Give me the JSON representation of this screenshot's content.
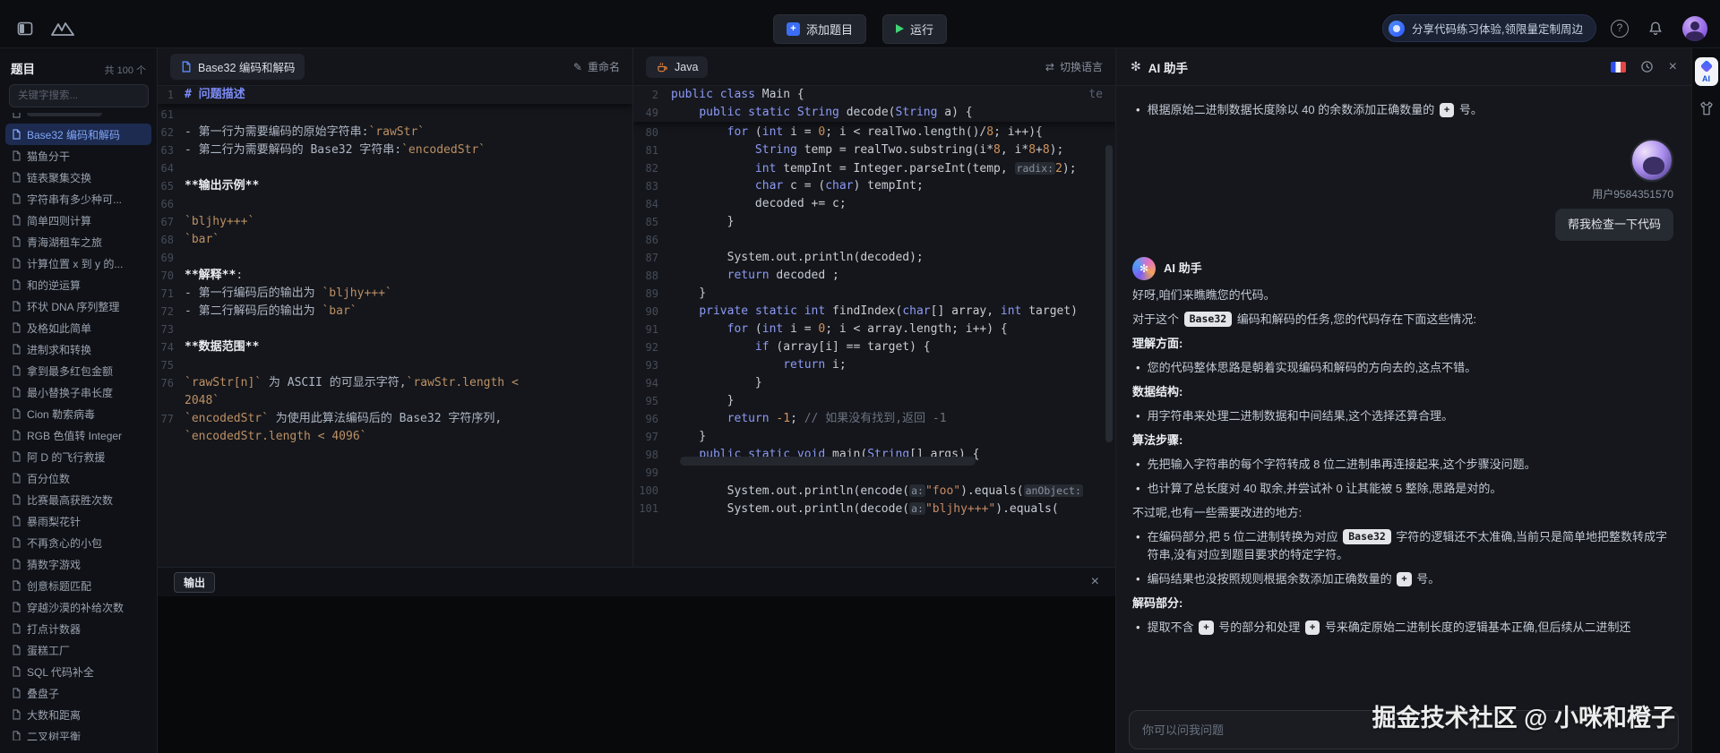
{
  "colors": {
    "accent_blue": "#3b6ef5",
    "run_green": "#3fd475",
    "java_orange": "#e8833a",
    "active_item_bg": "#1d2b50",
    "active_item_text": "#7fa5f7",
    "md_heading": "#7d8cf8",
    "inline_code": "#bd9064",
    "keyword": "#8d9af6",
    "number": "#d2945c",
    "comment": "#6b7280",
    "chip_bg": "#e3e5e9"
  },
  "topbar": {
    "add_button": "添加题目",
    "run_button": "运行",
    "banner": "分享代码练习体验,领限量定制周边",
    "help": "?"
  },
  "sidebar": {
    "title": "题目",
    "count": "共 100 个",
    "search_placeholder": "关键字搜索...",
    "items": [
      {
        "label": "Base32 编码和解码",
        "active": true
      },
      {
        "label": "猫鱼分干"
      },
      {
        "label": "链表聚集交换"
      },
      {
        "label": "字符串有多少种可..."
      },
      {
        "label": "简单四则计算"
      },
      {
        "label": "青海湖租车之旅"
      },
      {
        "label": "计算位置 x 到 y 的..."
      },
      {
        "label": "和的逆运算"
      },
      {
        "label": "环状 DNA 序列整理"
      },
      {
        "label": "及格如此简单"
      },
      {
        "label": "进制求和转换"
      },
      {
        "label": "拿到最多红包金额"
      },
      {
        "label": "最小替换子串长度"
      },
      {
        "label": "Cion 勒索病毒"
      },
      {
        "label": "RGB 色值转 Integer"
      },
      {
        "label": "阿 D 的飞行救援"
      },
      {
        "label": "百分位数"
      },
      {
        "label": "比赛最高获胜次数"
      },
      {
        "label": "暴雨梨花针"
      },
      {
        "label": "不再贪心的小包"
      },
      {
        "label": "猜数字游戏"
      },
      {
        "label": "创意标题匹配"
      },
      {
        "label": "穿越沙漠的补给次数"
      },
      {
        "label": "打点计数器"
      },
      {
        "label": "蛋糕工厂"
      },
      {
        "label": "SQL 代码补全"
      },
      {
        "label": "叠盘子"
      },
      {
        "label": "大数和距离"
      },
      {
        "label": "二叉树平衡"
      }
    ]
  },
  "problem": {
    "tab_label": "Base32 编码和解码",
    "rename_label": "重命名",
    "sticky": {
      "n": "1",
      "seg": [
        [
          "h",
          "# 问题描述"
        ]
      ]
    },
    "lines": [
      {
        "n": "61",
        "seg": []
      },
      {
        "n": "62",
        "seg": [
          [
            "t",
            "- 第一行为需要编码的原始字符串:"
          ],
          [
            "c",
            "`rawStr`"
          ]
        ]
      },
      {
        "n": "63",
        "seg": [
          [
            "t",
            "- 第二行为需要解码的 Base32 字符串:"
          ],
          [
            "c",
            "`encodedStr`"
          ]
        ]
      },
      {
        "n": "64",
        "seg": []
      },
      {
        "n": "65",
        "seg": [
          [
            "b",
            "**输出示例**"
          ]
        ]
      },
      {
        "n": "66",
        "seg": []
      },
      {
        "n": "67",
        "seg": [
          [
            "c",
            "`bljhy+++`"
          ]
        ]
      },
      {
        "n": "68",
        "seg": [
          [
            "c",
            "`bar`"
          ]
        ]
      },
      {
        "n": "69",
        "seg": []
      },
      {
        "n": "70",
        "seg": [
          [
            "b",
            "**解释**"
          ],
          [
            "t",
            ":"
          ]
        ]
      },
      {
        "n": "71",
        "seg": [
          [
            "t",
            "- 第一行编码后的输出为 "
          ],
          [
            "c",
            "`bljhy+++`"
          ]
        ]
      },
      {
        "n": "72",
        "seg": [
          [
            "t",
            "- 第二行解码后的输出为 "
          ],
          [
            "c",
            "`bar`"
          ]
        ]
      },
      {
        "n": "73",
        "seg": []
      },
      {
        "n": "74",
        "seg": [
          [
            "b",
            "**数据范围**"
          ]
        ]
      },
      {
        "n": "75",
        "seg": []
      },
      {
        "n": "76",
        "seg": [
          [
            "c",
            "`rawStr[n]`"
          ],
          [
            "t",
            " 为 ASCII 的可显示字符,"
          ],
          [
            "c",
            "`rawStr.length <"
          ]
        ]
      },
      {
        "n": "",
        "seg": [
          [
            "c",
            "2048`"
          ]
        ]
      },
      {
        "n": "77",
        "seg": [
          [
            "c",
            "`encodedStr`"
          ],
          [
            "t",
            " 为使用此算法编码后的 Base32 字符序列,"
          ]
        ]
      },
      {
        "n": "",
        "seg": [
          [
            "c",
            "`encodedStr.length < 4096`"
          ]
        ]
      }
    ]
  },
  "editor": {
    "tab_label": "Java",
    "switch_label": "切换语言",
    "sticky": [
      {
        "n": "2",
        "seg": [
          [
            "k",
            "public"
          ],
          [
            "p",
            " "
          ],
          [
            "k",
            "class"
          ],
          [
            "p",
            " Main {"
          ]
        ],
        "frag": "te"
      },
      {
        "n": "49",
        "seg": [
          [
            "p",
            "    "
          ],
          [
            "k",
            "public"
          ],
          [
            "p",
            " "
          ],
          [
            "k",
            "static"
          ],
          [
            "p",
            " "
          ],
          [
            "k",
            "String"
          ],
          [
            "p",
            " decode("
          ],
          [
            "k",
            "String"
          ],
          [
            "p",
            " a) {"
          ]
        ]
      }
    ],
    "lines": [
      {
        "n": "80",
        "seg": [
          [
            "p",
            "        "
          ],
          [
            "k",
            "for"
          ],
          [
            "p",
            " ("
          ],
          [
            "k",
            "int"
          ],
          [
            "p",
            " i = "
          ],
          [
            "n",
            "0"
          ],
          [
            "p",
            "; i < realTwo.length()/"
          ],
          [
            "n",
            "8"
          ],
          [
            "p",
            "; i++){"
          ]
        ]
      },
      {
        "n": "81",
        "seg": [
          [
            "p",
            "            "
          ],
          [
            "k",
            "String"
          ],
          [
            "p",
            " temp = realTwo.substring(i*"
          ],
          [
            "n",
            "8"
          ],
          [
            "p",
            ", i*"
          ],
          [
            "n",
            "8"
          ],
          [
            "p",
            "+"
          ],
          [
            "n",
            "8"
          ],
          [
            "p",
            ");"
          ]
        ]
      },
      {
        "n": "82",
        "seg": [
          [
            "p",
            "            "
          ],
          [
            "k",
            "int"
          ],
          [
            "p",
            " tempInt = Integer.parseInt(temp, "
          ],
          [
            "h",
            "radix:"
          ],
          [
            "n",
            "2"
          ],
          [
            "p",
            ");"
          ]
        ]
      },
      {
        "n": "83",
        "seg": [
          [
            "p",
            "            "
          ],
          [
            "k",
            "char"
          ],
          [
            "p",
            " c = ("
          ],
          [
            "k",
            "char"
          ],
          [
            "p",
            ") tempInt;"
          ]
        ]
      },
      {
        "n": "84",
        "seg": [
          [
            "p",
            "            decoded += c;"
          ]
        ]
      },
      {
        "n": "85",
        "seg": [
          [
            "p",
            "        }"
          ]
        ]
      },
      {
        "n": "86",
        "seg": []
      },
      {
        "n": "87",
        "seg": [
          [
            "p",
            "        System.out.println(decoded);"
          ]
        ]
      },
      {
        "n": "88",
        "seg": [
          [
            "p",
            "        "
          ],
          [
            "k",
            "return"
          ],
          [
            "p",
            " decoded ;"
          ]
        ]
      },
      {
        "n": "89",
        "seg": [
          [
            "p",
            "    }"
          ]
        ]
      },
      {
        "n": "90",
        "seg": [
          [
            "p",
            "    "
          ],
          [
            "k",
            "private"
          ],
          [
            "p",
            " "
          ],
          [
            "k",
            "static"
          ],
          [
            "p",
            " "
          ],
          [
            "k",
            "int"
          ],
          [
            "p",
            " findIndex("
          ],
          [
            "k",
            "char"
          ],
          [
            "p",
            "[] array, "
          ],
          [
            "k",
            "int"
          ],
          [
            "p",
            " target)"
          ]
        ]
      },
      {
        "n": "91",
        "seg": [
          [
            "p",
            "        "
          ],
          [
            "k",
            "for"
          ],
          [
            "p",
            " ("
          ],
          [
            "k",
            "int"
          ],
          [
            "p",
            " i = "
          ],
          [
            "n",
            "0"
          ],
          [
            "p",
            "; i < array.length; i++) {"
          ]
        ]
      },
      {
        "n": "92",
        "seg": [
          [
            "p",
            "            "
          ],
          [
            "k",
            "if"
          ],
          [
            "p",
            " (array[i] == target) {"
          ]
        ]
      },
      {
        "n": "93",
        "seg": [
          [
            "p",
            "                "
          ],
          [
            "k",
            "return"
          ],
          [
            "p",
            " i;"
          ]
        ]
      },
      {
        "n": "94",
        "seg": [
          [
            "p",
            "            }"
          ]
        ]
      },
      {
        "n": "95",
        "seg": [
          [
            "p",
            "        }"
          ]
        ]
      },
      {
        "n": "96",
        "seg": [
          [
            "p",
            "        "
          ],
          [
            "k",
            "return"
          ],
          [
            "p",
            " "
          ],
          [
            "n",
            "-1"
          ],
          [
            "p",
            "; "
          ],
          [
            "c",
            "// 如果没有找到,返回 -1"
          ]
        ]
      },
      {
        "n": "97",
        "seg": [
          [
            "p",
            "    }"
          ]
        ]
      },
      {
        "n": "98",
        "seg": [
          [
            "p",
            "    "
          ],
          [
            "k",
            "public"
          ],
          [
            "p",
            " "
          ],
          [
            "k",
            "static"
          ],
          [
            "p",
            " "
          ],
          [
            "k",
            "void"
          ],
          [
            "p",
            " main("
          ],
          [
            "k",
            "String"
          ],
          [
            "p",
            "[] args) {"
          ]
        ]
      },
      {
        "n": "99",
        "seg": []
      },
      {
        "n": "100",
        "seg": [
          [
            "p",
            "        System.out.println(encode("
          ],
          [
            "h",
            "a:"
          ],
          [
            "s",
            "\"foo\""
          ],
          [
            "p",
            ").equals("
          ],
          [
            "h",
            "anObject:"
          ]
        ]
      },
      {
        "n": "101",
        "seg": [
          [
            "p",
            "        System.out.println(decode("
          ],
          [
            "h",
            "a:"
          ],
          [
            "s",
            "\"bljhy+++\""
          ],
          [
            "p",
            ").equals("
          ]
        ]
      }
    ]
  },
  "output": {
    "tab_label": "输出",
    "close_label": "×"
  },
  "ai_panel": {
    "title": "AI 助手",
    "input_placeholder": "你可以问我问题",
    "watermark": "掘金技术社区 @ 小咪和橙子",
    "messages": [
      {
        "type": "bullet",
        "parts": [
          [
            "t",
            "根据原始二进制数据长度除以 40 的余数添加正确数量的 "
          ],
          [
            "badge",
            "+"
          ],
          [
            "t",
            " 号。"
          ]
        ]
      },
      {
        "type": "user",
        "name": "用户9584351570",
        "text": "帮我检查一下代码"
      },
      {
        "type": "ai-label",
        "text": "AI 助手"
      },
      {
        "type": "p",
        "parts": [
          [
            "t",
            "好呀,咱们来瞧瞧您的代码。"
          ]
        ]
      },
      {
        "type": "p",
        "parts": [
          [
            "t",
            "对于这个 "
          ],
          [
            "chip",
            "Base32"
          ],
          [
            "t",
            " 编码和解码的任务,您的代码存在下面这些情况:"
          ]
        ]
      },
      {
        "type": "p",
        "parts": [
          [
            "b",
            "理解方面:"
          ]
        ]
      },
      {
        "type": "bullet",
        "parts": [
          [
            "t",
            "您的代码整体思路是朝着实现编码和解码的方向去的,这点不错。"
          ]
        ]
      },
      {
        "type": "p",
        "parts": [
          [
            "b",
            "数据结构:"
          ]
        ]
      },
      {
        "type": "bullet",
        "parts": [
          [
            "t",
            "用字符串来处理二进制数据和中间结果,这个选择还算合理。"
          ]
        ]
      },
      {
        "type": "p",
        "parts": [
          [
            "b",
            "算法步骤:"
          ]
        ]
      },
      {
        "type": "bullet",
        "parts": [
          [
            "t",
            "先把输入字符串的每个字符转成 8 位二进制串再连接起来,这个步骤没问题。"
          ]
        ]
      },
      {
        "type": "bullet",
        "parts": [
          [
            "t",
            "也计算了总长度对 40 取余,并尝试补 0 让其能被 5 整除,思路是对的。"
          ]
        ]
      },
      {
        "type": "p",
        "parts": [
          [
            "t",
            "不过呢,也有一些需要改进的地方:"
          ]
        ]
      },
      {
        "type": "bullet",
        "parts": [
          [
            "t",
            "在编码部分,把 5 位二进制转换为对应 "
          ],
          [
            "chip",
            "Base32"
          ],
          [
            "t",
            " 字符的逻辑还不太准确,当前只是简单地把整数转成字符串,没有对应到题目要求的特定字符。"
          ]
        ]
      },
      {
        "type": "bullet",
        "parts": [
          [
            "t",
            "编码结果也没按照规则根据余数添加正确数量的 "
          ],
          [
            "badge",
            "+"
          ],
          [
            "t",
            " 号。"
          ]
        ]
      },
      {
        "type": "p",
        "parts": [
          [
            "b",
            "解码部分:"
          ]
        ]
      },
      {
        "type": "bullet",
        "parts": [
          [
            "t",
            "提取不含 "
          ],
          [
            "badge",
            "+"
          ],
          [
            "t",
            " 号的部分和处理 "
          ],
          [
            "badge",
            "+"
          ],
          [
            "t",
            " 号来确定原始二进制长度的逻辑基本正确,但后续从二进制还"
          ]
        ]
      }
    ]
  },
  "right_strip": {
    "ai_label": "AI"
  }
}
